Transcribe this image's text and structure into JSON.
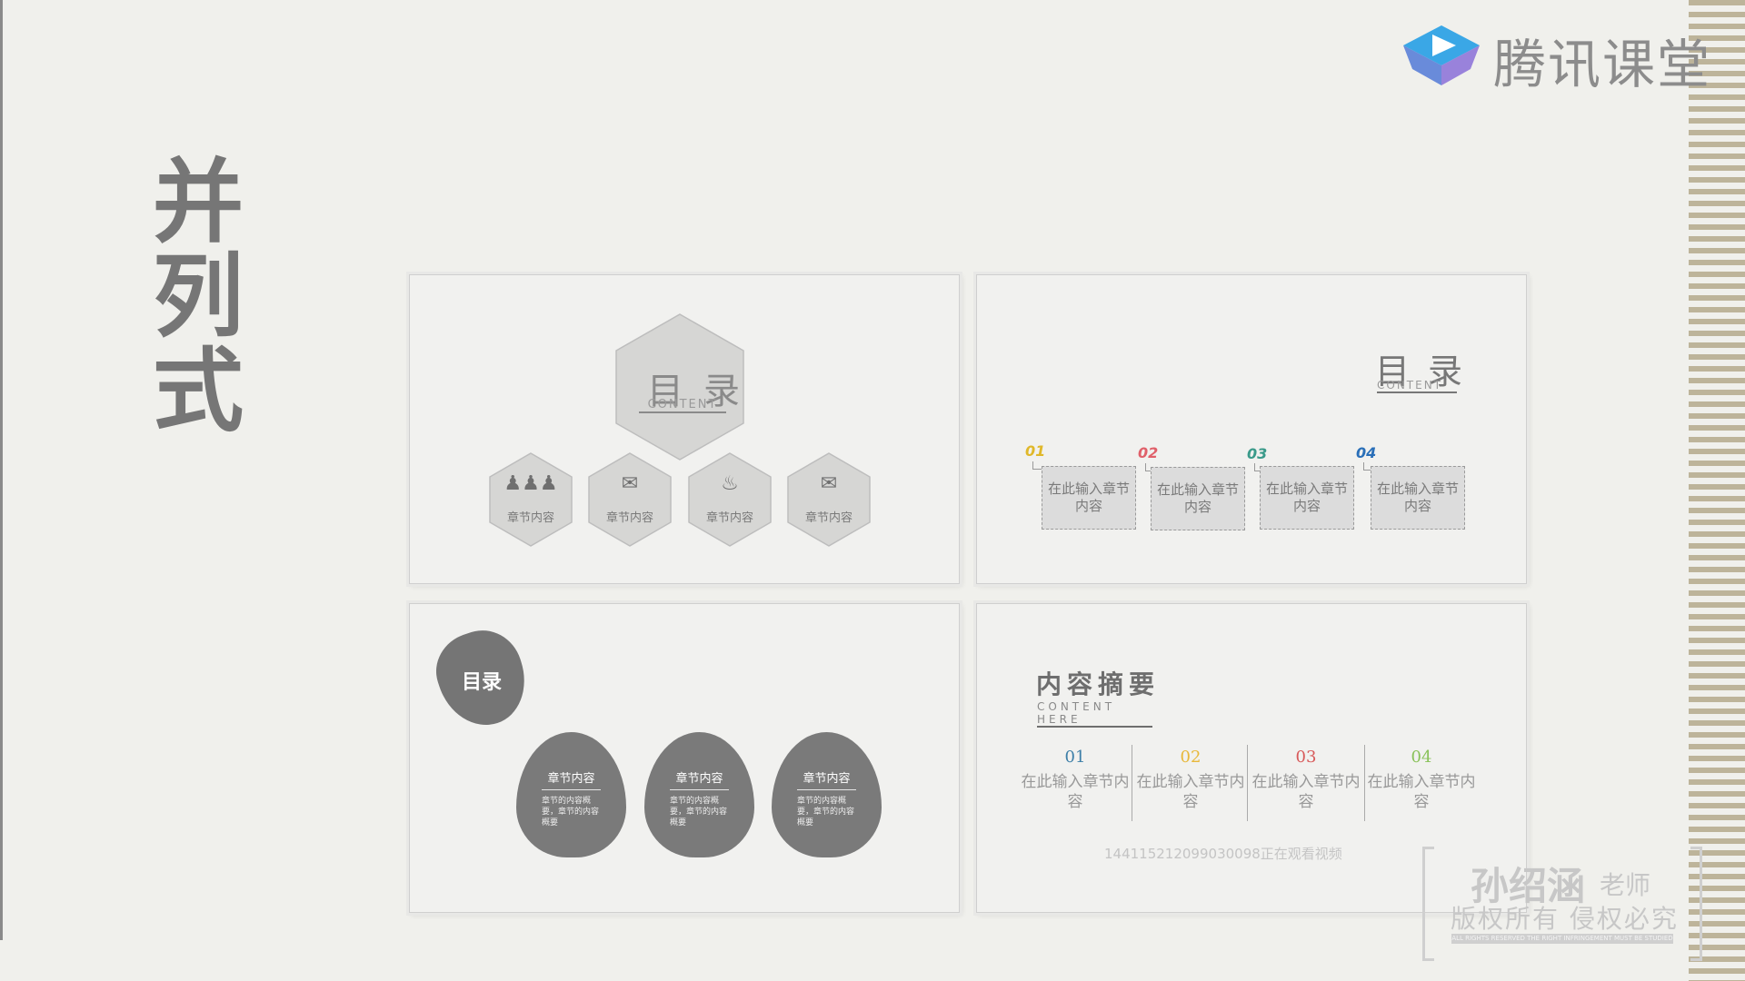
{
  "page": {
    "title_vertical": "并列式",
    "brand": {
      "logo_text": "腾讯课堂",
      "icon": "play-icon"
    }
  },
  "panel1": {
    "title": "目录",
    "subtitle": "CONTENT",
    "items": [
      {
        "icon": "people-icon",
        "label": "章节内容"
      },
      {
        "icon": "chat-icon",
        "label": "章节内容"
      },
      {
        "icon": "fire-icon",
        "label": "章节内容"
      },
      {
        "icon": "mail-icon",
        "label": "章节内容"
      }
    ]
  },
  "panel2": {
    "title": "目录",
    "subtitle": "CONTENT",
    "steps": [
      {
        "num": "01",
        "text": "在此输入章节内容",
        "color": "#e0b82a"
      },
      {
        "num": "02",
        "text": "在此输入章节内容",
        "color": "#e0606a"
      },
      {
        "num": "03",
        "text": "在此输入章节内容",
        "color": "#3a9a8a"
      },
      {
        "num": "04",
        "text": "在此输入章节内容",
        "color": "#2a6fb8"
      }
    ]
  },
  "panel3": {
    "title": "目录",
    "cards": [
      {
        "heading": "章节内容",
        "body": "章节的内容概要，章节的内容概要"
      },
      {
        "heading": "章节内容",
        "body": "章节的内容概要，章节的内容概要"
      },
      {
        "heading": "章节内容",
        "body": "章节的内容概要，章节的内容概要"
      }
    ]
  },
  "panel4": {
    "title": "内容摘要",
    "subtitle": "CONTENT HERE",
    "columns": [
      {
        "num": "01",
        "text": "在此输入章节内容",
        "color": "#3d7fa8"
      },
      {
        "num": "02",
        "text": "在此输入章节内容",
        "color": "#e8b83a"
      },
      {
        "num": "03",
        "text": "在此输入章节内容",
        "color": "#d85a5a"
      },
      {
        "num": "04",
        "text": "在此输入章节内容",
        "color": "#8ac25a"
      }
    ],
    "ticker": "144115212099030098正在观看视频"
  },
  "watermark": {
    "name": "孙绍涵",
    "role": "老师",
    "rights": "版权所有 侵权必究",
    "small": "ALL RIGHTS RESERVED THE RIGHT INFRINGEMENT MUST BE STUDIED"
  }
}
